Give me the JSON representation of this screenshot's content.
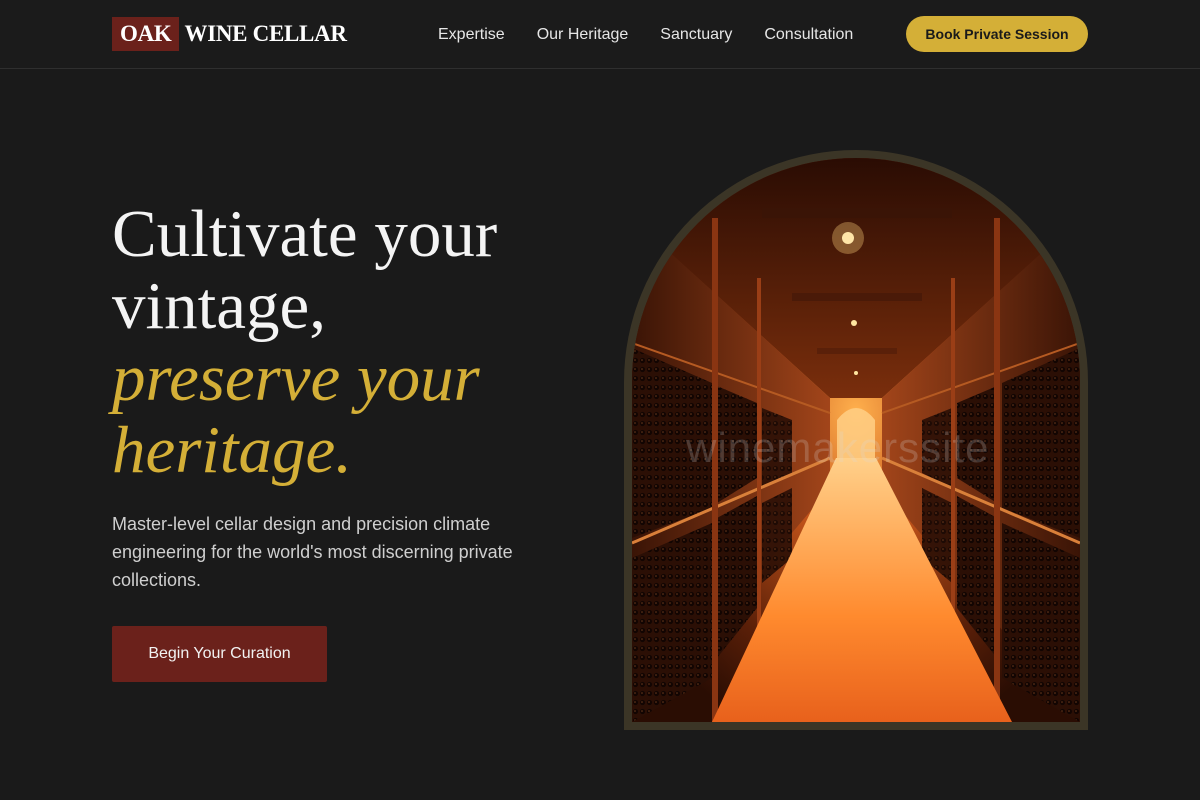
{
  "header": {
    "logo_box": "OAK",
    "logo_text": "WINE CELLAR",
    "nav": [
      "Expertise",
      "Our Heritage",
      "Sanctuary",
      "Consultation"
    ],
    "cta": "Book Private Session"
  },
  "hero": {
    "title_line1": "Cultivate your",
    "title_line2": "vintage,",
    "title_accent1": "preserve your",
    "title_accent2": "heritage.",
    "subtitle": "Master-level cellar design and precision climate engineering for the world's most discerning private collections.",
    "cta": "Begin Your Curation",
    "image_alt": "Wine cellar corridor lined with bottle racks under warm lighting",
    "watermark": "winemakerssite"
  },
  "colors": {
    "background": "#1a1a1a",
    "accent_gold": "#d4af37",
    "burgundy": "#6b211b",
    "arch_frame": "#3b3526"
  }
}
